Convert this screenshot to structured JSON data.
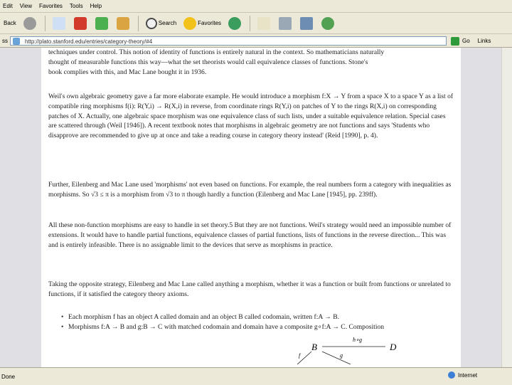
{
  "menu": [
    "Edit",
    "View",
    "Favorites",
    "Tools",
    "Help"
  ],
  "toolbar": {
    "back_label": "Back",
    "search_label": "Search",
    "favorites_label": "Favorites"
  },
  "address": {
    "label": "ss",
    "url": "http://plato.stanford.edu/entries/category-theory/#4",
    "go_label": "Go",
    "links_label": "Links"
  },
  "content": {
    "p1_line1": "techniques under control. This notion of identity of functions is entirely natural in the context. So mathematicians naturally",
    "p1_line2": "thought of measurable functions this way—what the set theorists would call equivalence classes of functions. Stone's",
    "p1_line3": "book complies with this, and Mac Lane bought it in 1936.",
    "p2": "Weil's own algebraic geometry gave a far more elaborate example. He would introduce a morphism f:X → Y from a space X to a space Y as a list of compatible ring morphisms f(i): R(Y,i) → R(X,i) in reverse, from coordinate rings R(Y,i) on patches of Y to the rings R(X,i) on corresponding patches of X. Actually, one algebraic space morphism was one equivalence class of such lists, under a suitable equivalence relation. Special cases are scattered through (Weil [1946]). A recent textbook notes that morphisms in algebraic geometry are not functions and says 'Students who disapprove are recommended to give up at once and take a reading course in category theory instead' (Reid [1990], p. 4).",
    "p3": "Further, Eilenberg and Mac Lane used 'morphisms' not even based on functions. For example, the real numbers form a category with inequalities as morphisms. So √3 ≤ π is a morphism from √3 to π though hardly a function (Eilenberg and Mac Lane [1945], pp. 239ff).",
    "p4": "All these non-function morphisms are easy to handle in set theory.5 But they are not functions. Weil's strategy would need an impossible number of extensions. It would have to handle partial functions, equivalence classes of partial functions, lists of functions in the reverse direction... This was and is entirely infeasible. There is no assignable limit to the devices that serve as morphisms in practice.",
    "p5": "Taking the opposite strategy, Eilenberg and Mac Lane called anything a morphism, whether it was a function or built from functions or unrelated to functions, if it satisfied the category theory axioms.",
    "bullet1": "Each morphism f has an object A called domain and an object B called codomain, written f:A → B.",
    "bullet2": "Morphisms f:A → B and g:B → C with matched codomain and domain have a composite g∘f:A → C. Composition",
    "diagram": {
      "B": "B",
      "D": "D",
      "f": "f",
      "g": "g",
      "hg": "h∘g"
    }
  },
  "status": {
    "left_text": "Done",
    "zone_text": "Internet"
  }
}
